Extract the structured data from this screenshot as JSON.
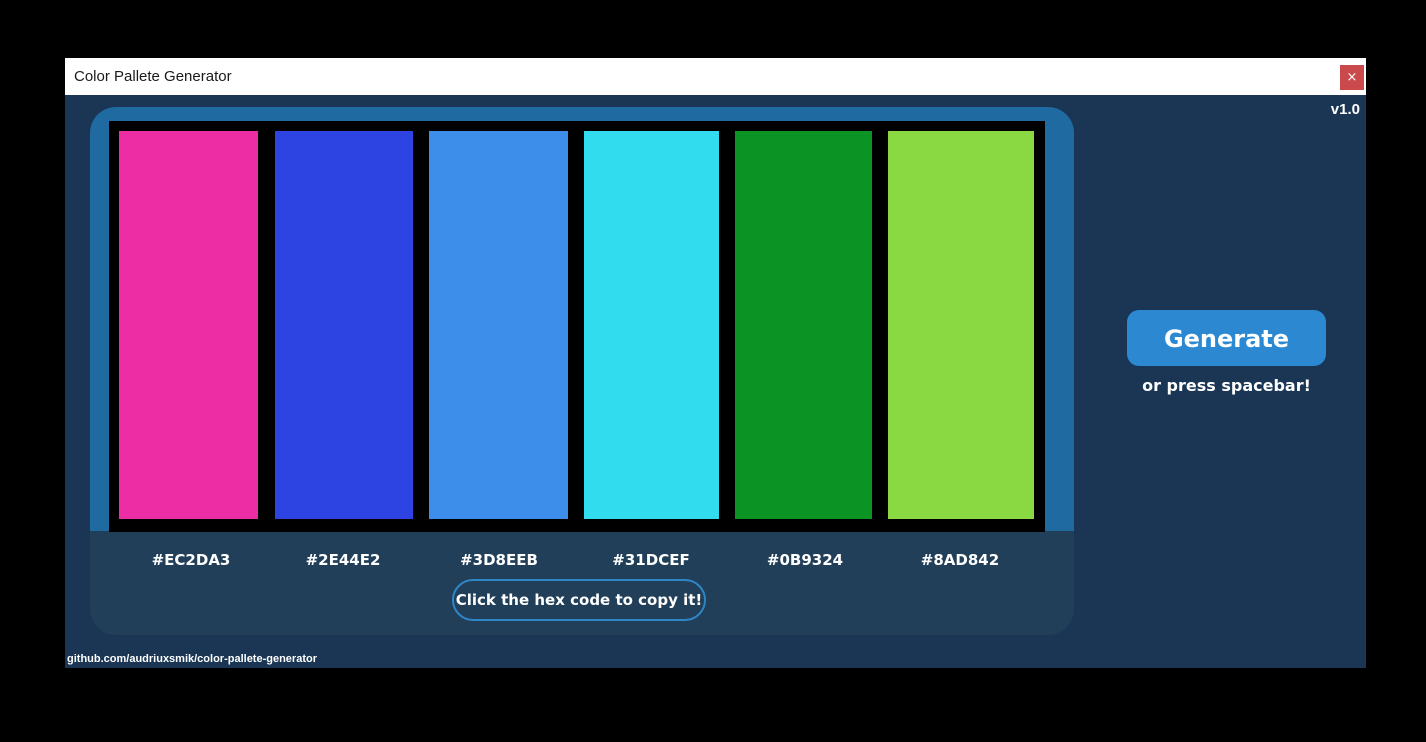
{
  "window": {
    "title": "Color Pallete Generator",
    "close_label": "×",
    "version": "v1.0"
  },
  "palette": {
    "swatches": [
      {
        "color": "#EC2DA3",
        "hex": "#EC2DA3"
      },
      {
        "color": "#2E44E2",
        "hex": "#2E44E2"
      },
      {
        "color": "#3D8EEB",
        "hex": "#3D8EEB"
      },
      {
        "color": "#31DCEF",
        "hex": "#31DCEF"
      },
      {
        "color": "#0B9324",
        "hex": "#0B9324"
      },
      {
        "color": "#8AD842",
        "hex": "#8AD842"
      }
    ],
    "copy_hint": "Click the hex code to copy it!"
  },
  "actions": {
    "generate_label": "Generate",
    "spacebar_hint": "or press spacebar!"
  },
  "footer": {
    "link_text": "github.com/audriuxsmik/color-pallete-generator"
  },
  "colors": {
    "window_bg": "#1a3654",
    "panel_top": "#1f6aa0",
    "panel_bottom": "#213f59",
    "generate_button": "#2b88d1",
    "close_button": "#c9494c"
  }
}
